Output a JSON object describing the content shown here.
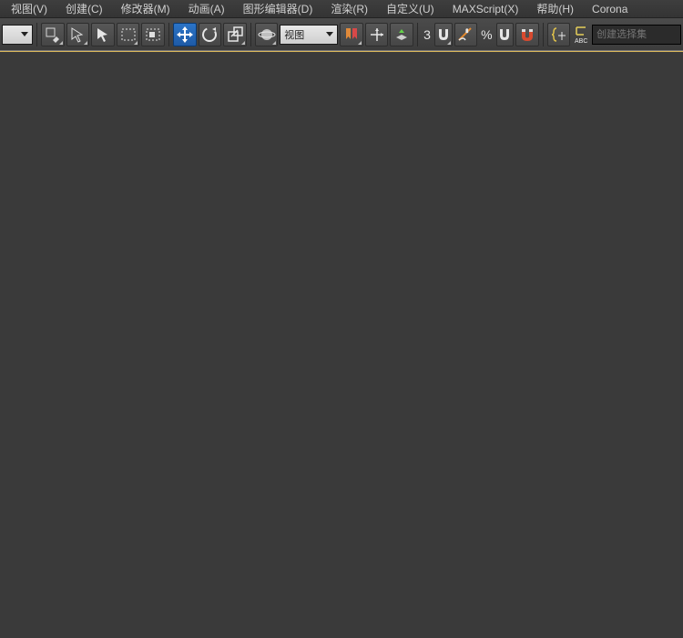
{
  "menu": {
    "items": [
      "视图(V)",
      "创建(C)",
      "修改器(M)",
      "动画(A)",
      "图形编辑器(D)",
      "渲染(R)",
      "自定义(U)",
      "MAXScript(X)",
      "帮助(H)",
      "Corona"
    ]
  },
  "toolbar": {
    "dropdown1": {
      "label": ""
    },
    "dropdown_ref": {
      "label": "视图"
    },
    "spinner_value": "3",
    "percent_label": "%",
    "selection_set_placeholder": "创建选择集"
  },
  "icons": {
    "select_link": "select-link",
    "selection_arrow_outline": "selection-arrow-outline",
    "selection_arrow_fill": "selection-arrow-fill",
    "marquee_rect": "marquee-rect",
    "marquee_window": "marquee-window",
    "move": "move",
    "rotate": "rotate",
    "scale": "scale",
    "ref_coord": "ref-coord",
    "planet": "planet",
    "align_bookmark": "align-bookmark",
    "axis_move": "axis-move",
    "layer_up": "layer-up",
    "angle_snap": "angle-snap",
    "percent_snap": "percent-snap",
    "magnet1": "magnet-small",
    "magnet2": "magnet-medium",
    "magnet3": "magnet-large",
    "named_sel": "named-selection",
    "script_abc": "script-abc"
  }
}
